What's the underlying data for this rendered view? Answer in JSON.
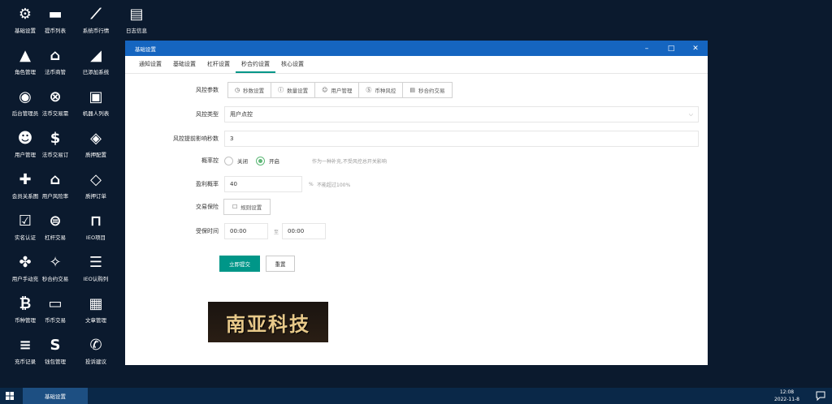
{
  "desktop": {
    "icons": [
      {
        "label": "基础设置",
        "icon": "gears-icon"
      },
      {
        "label": "提币列表",
        "icon": "card-icon"
      },
      {
        "label": "系统币行情",
        "icon": "chart-line-icon"
      },
      {
        "label": "日志信息",
        "icon": "document-icon"
      },
      {
        "label": "角色管理",
        "icon": "graduation-cap-icon"
      },
      {
        "label": "法币商管",
        "icon": "bank-icon"
      },
      {
        "label": "已添加系统",
        "icon": "area-chart-icon"
      },
      {
        "label": "后台管理员",
        "icon": "user-circle-icon"
      },
      {
        "label": "法币交易需",
        "icon": "link-icon"
      },
      {
        "label": "机器人列表",
        "icon": "robot-icon"
      },
      {
        "label": "用户管理",
        "icon": "users-icon"
      },
      {
        "label": "法币交易订",
        "icon": "dollar-icon"
      },
      {
        "label": "质押配置",
        "icon": "cube-icon"
      },
      {
        "label": "会员关系图",
        "icon": "user-plus-icon"
      },
      {
        "label": "用户风险率",
        "icon": "home-icon"
      },
      {
        "label": "质押订单",
        "icon": "cube-outline-icon"
      },
      {
        "label": "实名认证",
        "icon": "check-square-icon"
      },
      {
        "label": "杠杆交易",
        "icon": "coin-icon"
      },
      {
        "label": "IEO项目",
        "icon": "unlock-icon"
      },
      {
        "label": "用户手动充",
        "icon": "puzzle-icon"
      },
      {
        "label": "秒合约交易",
        "icon": "rebel-icon"
      },
      {
        "label": "IEO认购列",
        "icon": "list-icon"
      },
      {
        "label": "币种管理",
        "icon": "bitcoin-icon"
      },
      {
        "label": "币币交易",
        "icon": "money-icon"
      },
      {
        "label": "文章管理",
        "icon": "newspaper-icon"
      },
      {
        "label": "充币记录",
        "icon": "list-bars-icon"
      },
      {
        "label": "钱包管理",
        "icon": "skype-icon"
      },
      {
        "label": "投诉建议",
        "icon": "phone-icon"
      }
    ]
  },
  "window": {
    "title": "基础设置",
    "tabs": [
      "通知设置",
      "基础设置",
      "杠杆设置",
      "秒合约设置",
      "核心设置"
    ],
    "active_tab": "秒合约设置"
  },
  "form": {
    "risk_param": {
      "label": "风控参数",
      "buttons": [
        {
          "label": "秒数设置",
          "icon": "clock-icon"
        },
        {
          "label": "数量设置",
          "icon": "info-circle-icon"
        },
        {
          "label": "用户管理",
          "icon": "user-icon"
        },
        {
          "label": "币种风控",
          "icon": "dollar-circle-icon"
        },
        {
          "label": "秒合约交易",
          "icon": "file-icon"
        }
      ]
    },
    "risk_type": {
      "label": "风控类型",
      "value": "用户点控"
    },
    "risk_seconds": {
      "label": "风控提前影响秒数",
      "value": "3"
    },
    "probability_control": {
      "label": "概率控",
      "options": [
        "关闭",
        "开启"
      ],
      "selected": "开启",
      "hint": "作为一种补充,不受风控总开关影响"
    },
    "profit_rate": {
      "label": "盈利概率",
      "value": "40",
      "unit": "%",
      "hint": "不能超过100%"
    },
    "trade_protect": {
      "label": "交易保险",
      "button": "规则设置"
    },
    "protect_time": {
      "label": "受保时间",
      "from": "00:00",
      "sep": "至",
      "to": "00:00"
    },
    "submit": "立即提交",
    "reset": "重置"
  },
  "logo_text": "南亚科技",
  "taskbar": {
    "app": "基础设置",
    "time": "12:08",
    "date": "2022-11-8"
  },
  "colors": {
    "desktop_bg": "#0b1a2e",
    "titlebar": "#1565c0",
    "primary": "#009688",
    "radio_on": "#5fb878",
    "taskbar": "#0a2848"
  }
}
